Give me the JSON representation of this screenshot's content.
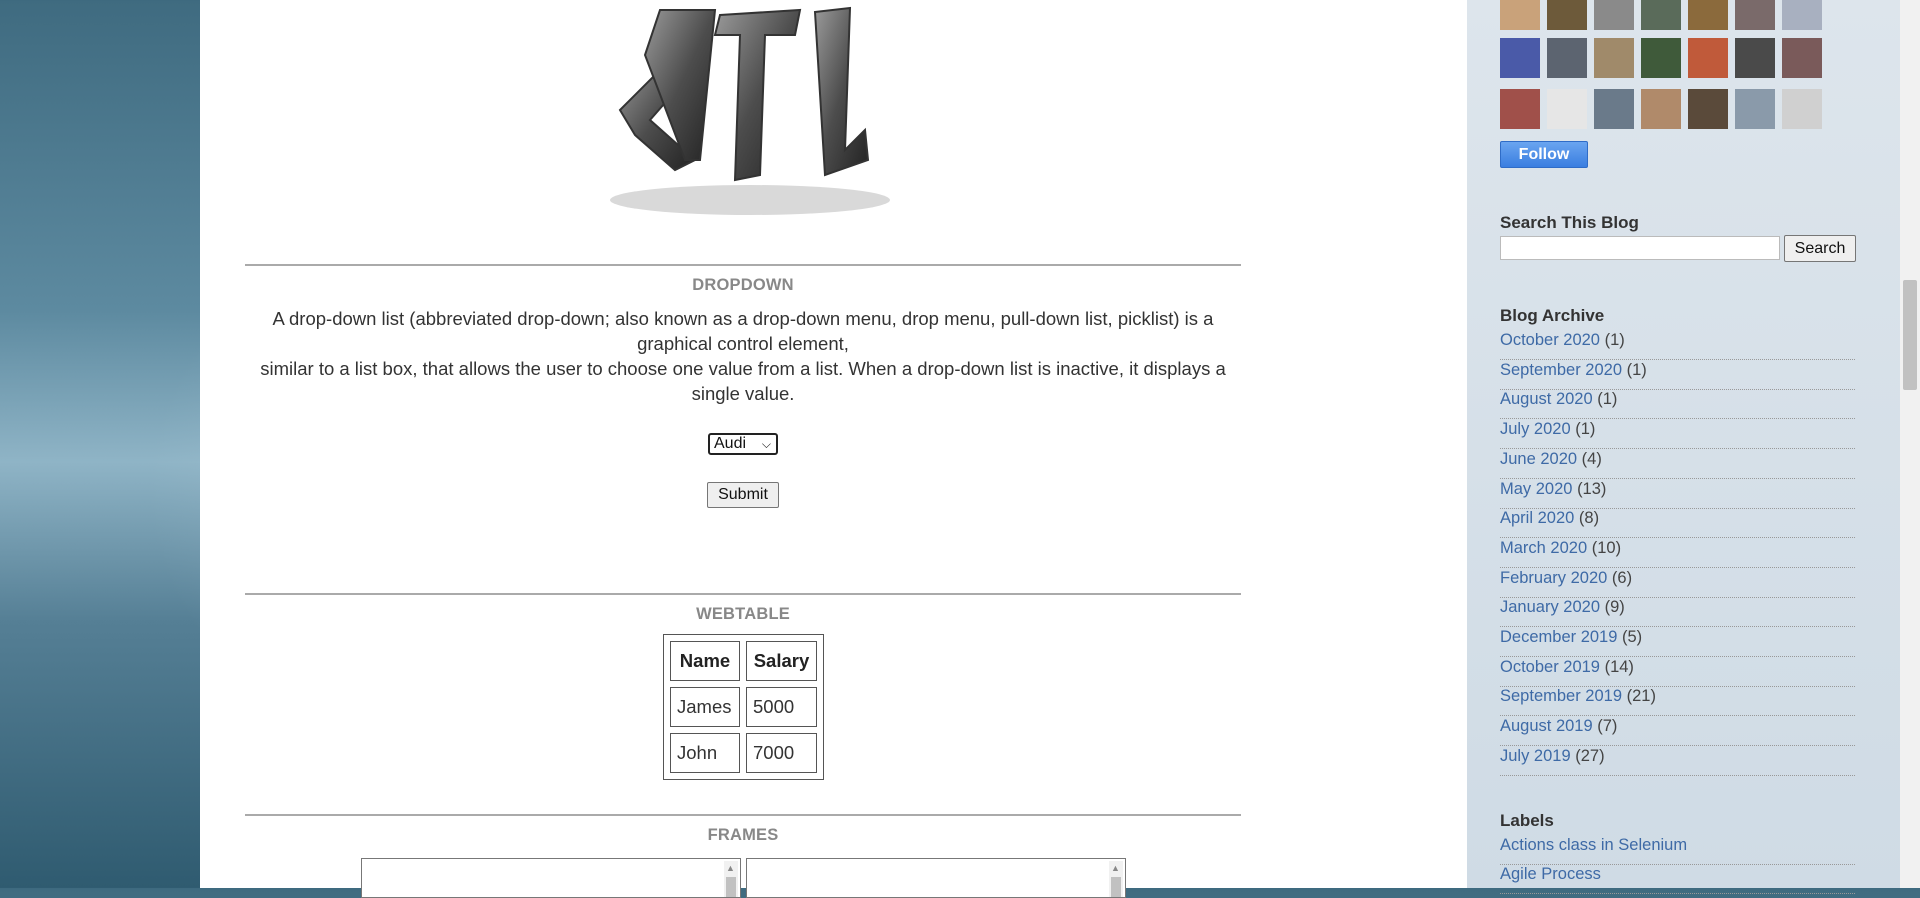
{
  "dropdown": {
    "title": "DROPDOWN",
    "description_line1": "A drop-down list (abbreviated drop-down; also known as a drop-down menu, drop menu, pull-down list, picklist) is a",
    "description_line2": "graphical control element,",
    "description_line3": "similar to a list box, that allows the user to choose one value from a list. When a drop-down list is inactive, it displays a",
    "description_line4": "single value.",
    "selected": "Audi",
    "submit_label": "Submit"
  },
  "webtable": {
    "title": "WEBTABLE",
    "headers": [
      "Name",
      "Salary"
    ],
    "rows": [
      [
        "James",
        "5000"
      ],
      [
        "John",
        "7000"
      ]
    ]
  },
  "frames": {
    "title": "FRAMES"
  },
  "sidebar": {
    "follow_label": "Follow",
    "search": {
      "title": "Search This Blog",
      "button": "Search"
    },
    "archive": {
      "title": "Blog Archive",
      "items": [
        {
          "label": "October 2020",
          "count": "(1)"
        },
        {
          "label": "September 2020",
          "count": "(1)"
        },
        {
          "label": "August 2020",
          "count": "(1)"
        },
        {
          "label": "July 2020",
          "count": "(1)"
        },
        {
          "label": "June 2020",
          "count": "(4)"
        },
        {
          "label": "May 2020",
          "count": "(13)"
        },
        {
          "label": "April 2020",
          "count": "(8)"
        },
        {
          "label": "March 2020",
          "count": "(10)"
        },
        {
          "label": "February 2020",
          "count": "(6)"
        },
        {
          "label": "January 2020",
          "count": "(9)"
        },
        {
          "label": "December 2019",
          "count": "(5)"
        },
        {
          "label": "October 2019",
          "count": "(14)"
        },
        {
          "label": "September 2019",
          "count": "(21)"
        },
        {
          "label": "August 2019",
          "count": "(7)"
        },
        {
          "label": "July 2019",
          "count": "(27)"
        }
      ]
    },
    "labels": {
      "title": "Labels",
      "items": [
        "Actions class in Selenium",
        "Agile Process"
      ]
    }
  }
}
